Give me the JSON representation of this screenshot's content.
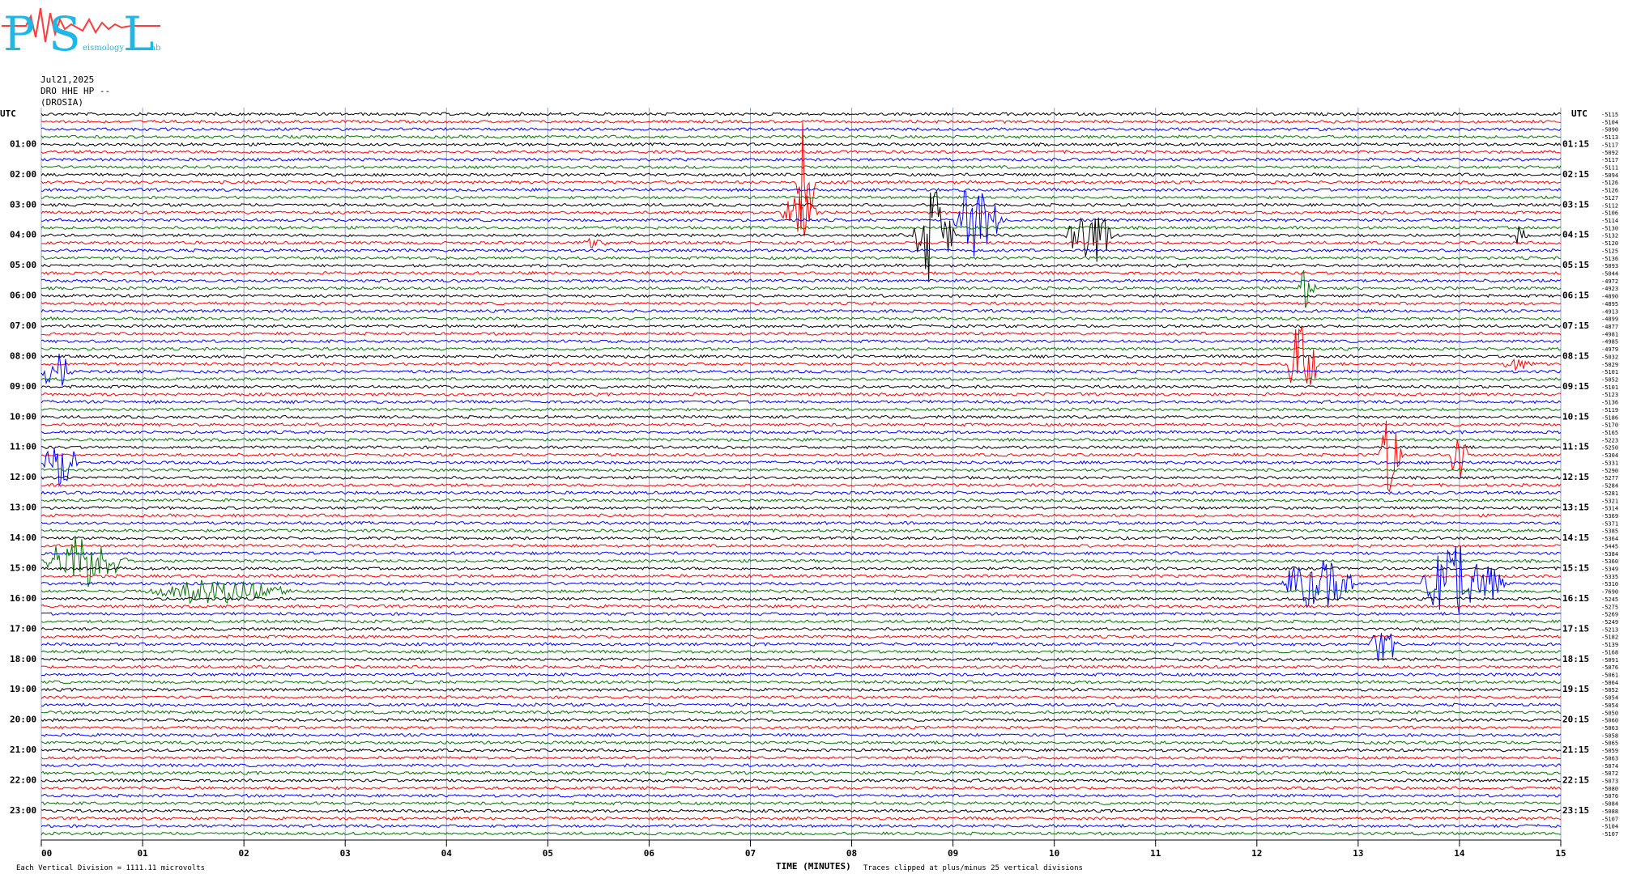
{
  "logo": {
    "letter_p": "P",
    "letter_s": "S",
    "letter_l": "L",
    "word_mid": "eismology",
    "word_end": "ab"
  },
  "header": {
    "date": "Jul21,2025",
    "station": "DRO HHE HP --",
    "place": "(DROSIA)"
  },
  "axis": {
    "left_title": "UTC",
    "right_title": "UTC"
  },
  "footer": {
    "left": "Each Vertical Division = 1111.11 microvolts",
    "xlabel": "TIME (MINUTES)",
    "note": "Traces clipped at plus/minus 25 vertical divisions"
  },
  "chart_data": {
    "type": "line",
    "title": "",
    "xlabel": "TIME (MINUTES)",
    "ylabel": "UTC",
    "xlim": [
      0,
      15
    ],
    "x_ticks": [
      "00",
      "01",
      "02",
      "03",
      "04",
      "05",
      "06",
      "07",
      "08",
      "09",
      "10",
      "11",
      "12",
      "13",
      "14",
      "15"
    ],
    "traces_per_hour": 4,
    "num_traces": 96,
    "trace_colors": [
      "#000000",
      "#ff0000",
      "#0000ff",
      "#007700"
    ],
    "left_labels": [
      "01:00",
      "02:00",
      "03:00",
      "04:00",
      "05:00",
      "06:00",
      "07:00",
      "08:00",
      "09:00",
      "10:00",
      "11:00",
      "12:00",
      "13:00",
      "14:00",
      "15:00",
      "16:00",
      "17:00",
      "18:00",
      "19:00",
      "20:00",
      "21:00",
      "22:00",
      "23:00"
    ],
    "right_labels": [
      "01:15",
      "02:15",
      "03:15",
      "04:15",
      "05:15",
      "06:15",
      "07:15",
      "08:15",
      "09:15",
      "10:15",
      "11:15",
      "12:15",
      "13:15",
      "14:15",
      "15:15",
      "16:15",
      "17:15",
      "18:15",
      "19:15",
      "20:15",
      "21:15",
      "22:15",
      "23:15"
    ],
    "offsets": [
      "-5115",
      "-5104",
      "-5090",
      "-5113",
      "-5117",
      "-5092",
      "-5117",
      "-5111",
      "-5094",
      "-5126",
      "-5126",
      "-5127",
      "-5112",
      "-5106",
      "-5114",
      "-5130",
      "-5132",
      "-5120",
      "-5125",
      "-5136",
      "-5093",
      "-5044",
      "-4972",
      "-4923",
      "-4890",
      "-4895",
      "-4913",
      "-4899",
      "-4877",
      "-4981",
      "-4985",
      "-4979",
      "-5032",
      "-5029",
      "-5101",
      "-5052",
      "-5101",
      "-5123",
      "-5136",
      "-5119",
      "-5186",
      "-5170",
      "-5165",
      "-5223",
      "-5250",
      "-5304",
      "-5331",
      "-5290",
      "-5277",
      "-5284",
      "-5281",
      "-5321",
      "-5314",
      "-5369",
      "-5371",
      "-5385",
      "-5364",
      "-5445",
      "-5384",
      "-5360",
      "-5349",
      "-5335",
      "-5310",
      "-7690",
      "-5245",
      "-5275",
      "-5269",
      "-5249",
      "-5213",
      "-5182",
      "-5139",
      "-5168",
      "-5091",
      "-5076",
      "-5061",
      "-5064",
      "-5052",
      "-5054",
      "-5054",
      "-5050",
      "-5060",
      "-5063",
      "-5058",
      "-5065",
      "-5059",
      "-5063",
      "-5074",
      "-5072",
      "-5073",
      "-5080",
      "-5076",
      "-5084",
      "-5088",
      "-5107",
      "-5104",
      "-5107"
    ],
    "events": [
      {
        "trace": 9,
        "start_min": 7.45,
        "end_min": 7.75,
        "amp": 95
      },
      {
        "trace": 13,
        "start_min": 7.3,
        "end_min": 7.9,
        "amp": 40
      },
      {
        "trace": 16,
        "start_min": 8.6,
        "end_min": 9.3,
        "amp": 70
      },
      {
        "trace": 14,
        "start_min": 9.0,
        "end_min": 9.8,
        "amp": 60
      },
      {
        "trace": 16,
        "start_min": 10.1,
        "end_min": 10.9,
        "amp": 50
      },
      {
        "trace": 33,
        "start_min": 12.3,
        "end_min": 12.8,
        "amp": 70
      },
      {
        "trace": 45,
        "start_min": 13.2,
        "end_min": 13.6,
        "amp": 60
      },
      {
        "trace": 45,
        "start_min": 13.9,
        "end_min": 14.2,
        "amp": 40
      },
      {
        "trace": 34,
        "start_min": 0,
        "end_min": 0.5,
        "amp": 35
      },
      {
        "trace": 46,
        "start_min": 0,
        "end_min": 0.6,
        "amp": 40
      },
      {
        "trace": 59,
        "start_min": 0,
        "end_min": 1.4,
        "amp": 40
      },
      {
        "trace": 63,
        "start_min": 1.0,
        "end_min": 3.5,
        "amp": 18
      },
      {
        "trace": 62,
        "start_min": 12.2,
        "end_min": 13.5,
        "amp": 40
      },
      {
        "trace": 62,
        "start_min": 13.6,
        "end_min": 15,
        "amp": 60
      },
      {
        "trace": 70,
        "start_min": 13.1,
        "end_min": 13.6,
        "amp": 35
      },
      {
        "trace": 23,
        "start_min": 12.4,
        "end_min": 12.7,
        "amp": 30
      },
      {
        "trace": 16,
        "start_min": 14.5,
        "end_min": 14.8,
        "amp": 12
      },
      {
        "trace": 17,
        "start_min": 5.3,
        "end_min": 5.8,
        "amp": 8
      },
      {
        "trace": 33,
        "start_min": 14.4,
        "end_min": 15,
        "amp": 10
      }
    ]
  }
}
